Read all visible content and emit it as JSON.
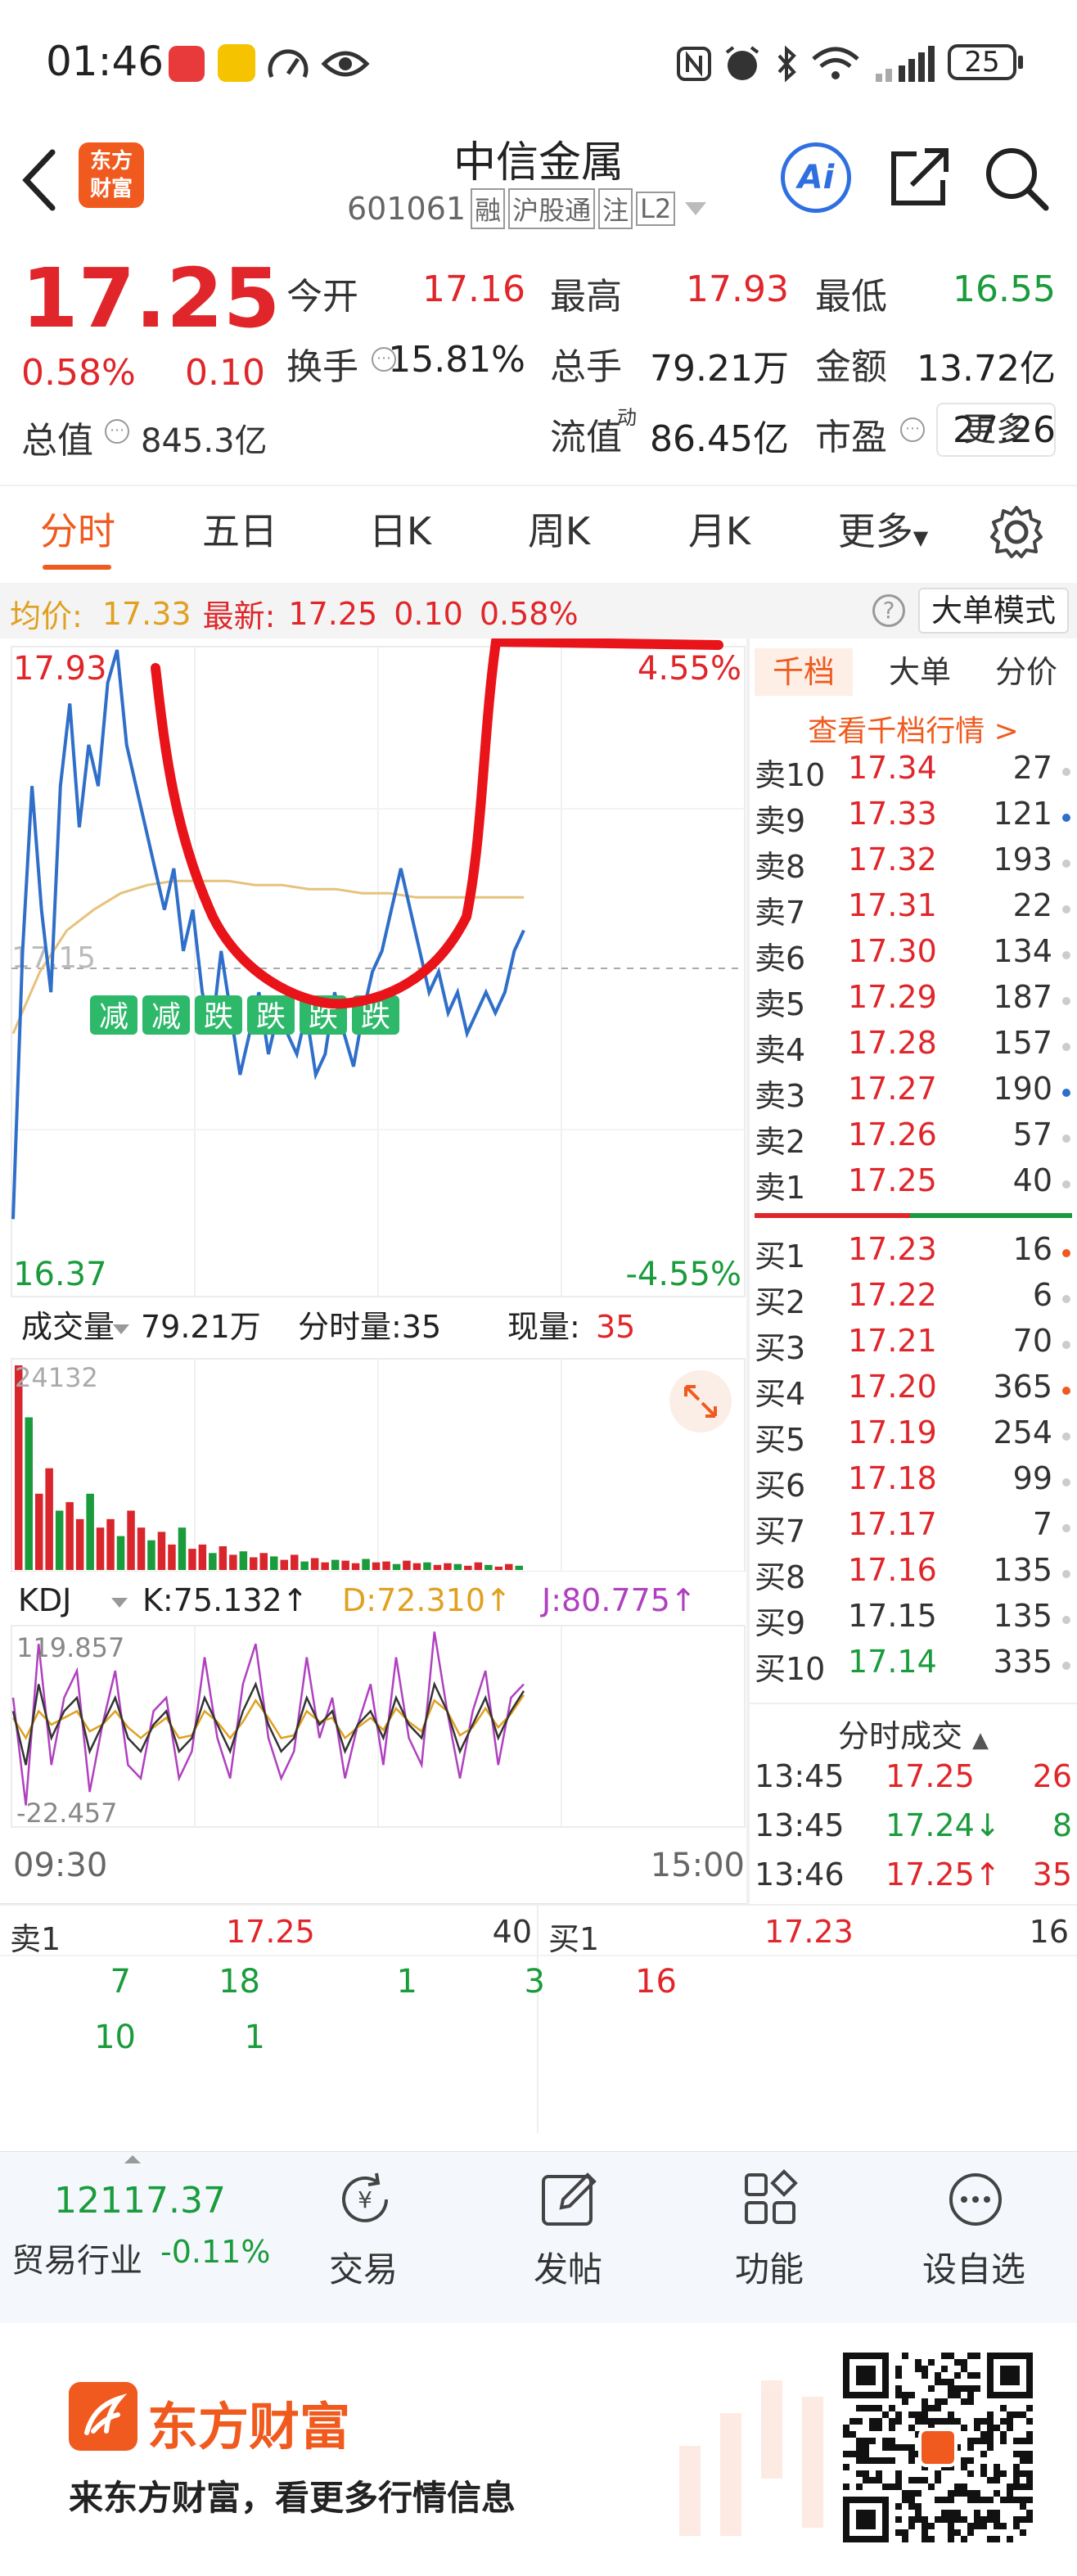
{
  "status_bar": {
    "time": "01:46",
    "battery": "25"
  },
  "header": {
    "title": "中信金属",
    "code": "601061",
    "tags": [
      "融",
      "沪股通",
      "注",
      "L2"
    ],
    "logo_text": [
      "东方",
      "财富"
    ],
    "ai_label": "Ai"
  },
  "quote": {
    "price": "17.25",
    "change_pct": "0.58%",
    "change": "0.10",
    "stats": [
      {
        "label": "今开",
        "value": "17.16",
        "color": "red"
      },
      {
        "label": "最高",
        "value": "17.93",
        "color": "red"
      },
      {
        "label": "最低",
        "value": "16.55",
        "color": "green"
      },
      {
        "label": "换手",
        "value": "15.81%",
        "color": "black"
      },
      {
        "label": "总手",
        "value": "79.21万",
        "color": "black"
      },
      {
        "label": "金额",
        "value": "13.72亿",
        "color": "black"
      },
      {
        "label": "总值",
        "value": "845.3亿",
        "color": "black"
      },
      {
        "label": "流值",
        "value": "86.45亿",
        "color": "black"
      },
      {
        "label": "市盈",
        "value": "27.26",
        "color": "black"
      }
    ],
    "pe_superscript": "动",
    "more_button": "更多"
  },
  "tabs": [
    "分时",
    "五日",
    "日K",
    "周K",
    "月K",
    "更多"
  ],
  "chart_bar": {
    "avg_label": "均价:",
    "avg_value": "17.33",
    "latest_label": "最新:",
    "latest_value": "17.25",
    "latest_change": "0.10",
    "latest_pct": "0.58%",
    "mode_button": "大单模式"
  },
  "chart_data": {
    "type": "line",
    "price_high": "17.93",
    "price_low": "16.37",
    "pct_high": "4.55%",
    "pct_low": "-4.55%",
    "prev_close": "17.15",
    "x_start": "09:30",
    "x_end": "15:00",
    "price_series": [
      16.55,
      17.2,
      17.6,
      17.3,
      17.1,
      17.6,
      17.8,
      17.5,
      17.7,
      17.6,
      17.85,
      17.93,
      17.7,
      17.6,
      17.5,
      17.4,
      17.3,
      17.4,
      17.2,
      17.3,
      17.1,
      17.0,
      17.2,
      17.05,
      16.9,
      17.0,
      17.1,
      16.95,
      17.05,
      17.0,
      16.95,
      17.05,
      16.9,
      16.95,
      17.1,
      17.0,
      16.92,
      17.05,
      17.15,
      17.2,
      17.3,
      17.4,
      17.3,
      17.2,
      17.1,
      17.15,
      17.05,
      17.1,
      17.0,
      17.05,
      17.1,
      17.05,
      17.1,
      17.2,
      17.25
    ],
    "avg_series": [
      17.0,
      17.15,
      17.25,
      17.3,
      17.34,
      17.36,
      17.37,
      17.37,
      17.37,
      17.36,
      17.36,
      17.35,
      17.35,
      17.34,
      17.34,
      17.33,
      17.33,
      17.33,
      17.33,
      17.33
    ],
    "badges": [
      "减",
      "减",
      "跌",
      "跌",
      "跌",
      "跌"
    ],
    "volume_label": "成交量",
    "volume_total": "79.21万",
    "volume_min_label": "分时量:35",
    "volume_now_label": "现量:",
    "volume_now_value": "35",
    "volume_max": "24132",
    "volume_series": [
      24132,
      18000,
      9000,
      12000,
      7000,
      8000,
      6000,
      9000,
      5000,
      6000,
      4000,
      7000,
      5000,
      3500,
      4500,
      3000,
      5000,
      2500,
      3000,
      2000,
      2800,
      1800,
      2200,
      1500,
      2000,
      1600,
      1200,
      1800,
      1000,
      1400,
      900,
      1200,
      1100,
      800,
      1300,
      900,
      1000,
      700,
      1100,
      800,
      900,
      600,
      800,
      700,
      500,
      900,
      600,
      400,
      700,
      500
    ],
    "kdj_label": "KDJ",
    "k_label": "K:75.132↑",
    "d_label": "D:72.310↑",
    "j_label": "J:80.775↑",
    "kdj_max": "119.857",
    "kdj_min": "-22.457",
    "k_series": [
      60,
      20,
      80,
      40,
      60,
      70,
      30,
      50,
      70,
      40,
      30,
      50,
      60,
      30,
      40,
      70,
      50,
      30,
      60,
      80,
      50,
      30,
      40,
      70,
      50,
      60,
      30,
      50,
      60,
      40,
      70,
      50,
      40,
      80,
      60,
      30,
      50,
      70,
      40,
      60,
      75
    ],
    "d_series": [
      55,
      40,
      60,
      50,
      55,
      60,
      45,
      50,
      60,
      48,
      40,
      48,
      55,
      40,
      42,
      60,
      52,
      40,
      52,
      68,
      55,
      40,
      42,
      60,
      52,
      55,
      40,
      48,
      55,
      46,
      62,
      52,
      45,
      68,
      60,
      42,
      48,
      62,
      48,
      58,
      72
    ],
    "j_series": [
      70,
      -10,
      110,
      20,
      70,
      90,
      0,
      50,
      90,
      20,
      10,
      60,
      70,
      10,
      30,
      100,
      40,
      10,
      80,
      110,
      40,
      10,
      30,
      100,
      40,
      70,
      10,
      50,
      80,
      20,
      100,
      40,
      20,
      119,
      60,
      10,
      60,
      90,
      20,
      70,
      80
    ]
  },
  "order_book": {
    "tabs": [
      "千档",
      "大单",
      "分价"
    ],
    "link": "查看千档行情 >",
    "asks": [
      {
        "label": "卖10",
        "price": "17.34",
        "qty": "27"
      },
      {
        "label": "卖9",
        "price": "17.33",
        "qty": "121"
      },
      {
        "label": "卖8",
        "price": "17.32",
        "qty": "193"
      },
      {
        "label": "卖7",
        "price": "17.31",
        "qty": "22"
      },
      {
        "label": "卖6",
        "price": "17.30",
        "qty": "134"
      },
      {
        "label": "卖5",
        "price": "17.29",
        "qty": "187"
      },
      {
        "label": "卖4",
        "price": "17.28",
        "qty": "157"
      },
      {
        "label": "卖3",
        "price": "17.27",
        "qty": "190"
      },
      {
        "label": "卖2",
        "price": "17.26",
        "qty": "57"
      },
      {
        "label": "卖1",
        "price": "17.25",
        "qty": "40"
      }
    ],
    "bids": [
      {
        "label": "买1",
        "price": "17.23",
        "qty": "16"
      },
      {
        "label": "买2",
        "price": "17.22",
        "qty": "6"
      },
      {
        "label": "买3",
        "price": "17.21",
        "qty": "70"
      },
      {
        "label": "买4",
        "price": "17.20",
        "qty": "365"
      },
      {
        "label": "买5",
        "price": "17.19",
        "qty": "254"
      },
      {
        "label": "买6",
        "price": "17.18",
        "qty": "99"
      },
      {
        "label": "买7",
        "price": "17.17",
        "qty": "7"
      },
      {
        "label": "买8",
        "price": "17.16",
        "qty": "135"
      },
      {
        "label": "买9",
        "price": "17.15",
        "qty": "135"
      },
      {
        "label": "买10",
        "price": "17.14",
        "qty": "335"
      }
    ],
    "ticks_title": "分时成交",
    "ticks": [
      {
        "time": "13:45",
        "price": "17.25",
        "qty": "26"
      },
      {
        "time": "13:45",
        "price": "17.24↓",
        "qty": "8"
      },
      {
        "time": "13:46",
        "price": "17.25↑",
        "qty": "35"
      }
    ]
  },
  "queue": {
    "sell_label": "卖1",
    "sell_price": "17.25",
    "sell_qty": "40",
    "buy_label": "买1",
    "buy_price": "17.23",
    "buy_qty": "16",
    "sell_orders_row1": [
      "7",
      "18",
      "1",
      "3"
    ],
    "sell_orders_row2": [
      "10",
      "1"
    ],
    "buy_orders": [
      "16"
    ]
  },
  "bottom_nav": {
    "index_value": "12117.37",
    "index_name": "贸易行业",
    "index_change": "-0.11%",
    "items": [
      "交易",
      "发帖",
      "功能",
      "设自选"
    ]
  },
  "ad": {
    "brand": "东方财富",
    "slogan": "来东方财富，看更多行情信息"
  }
}
